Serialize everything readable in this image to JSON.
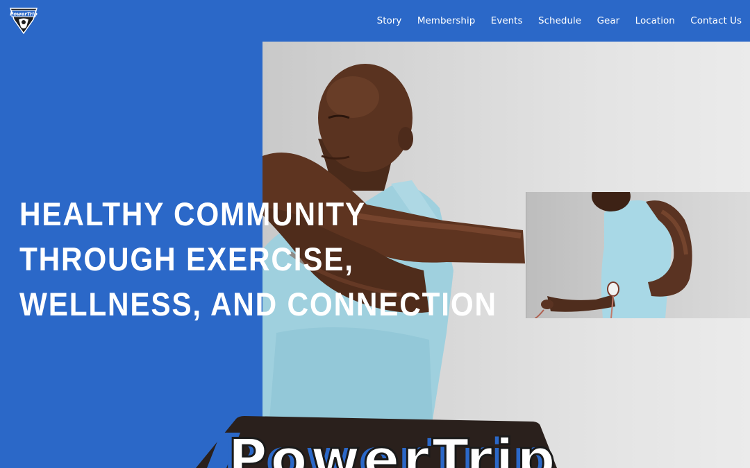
{
  "brand": {
    "logo_text": "PowerTrip",
    "badge_text": "PowerTrip"
  },
  "nav": {
    "items": [
      {
        "label": "Story"
      },
      {
        "label": "Membership"
      },
      {
        "label": "Events"
      },
      {
        "label": "Schedule"
      },
      {
        "label": "Gear"
      },
      {
        "label": "Location"
      },
      {
        "label": "Contact Us"
      }
    ]
  },
  "hero": {
    "heading_lines": [
      "HEALTHY COMMUNITY",
      "THROUGH EXERCISE,",
      "WELLNESS, AND CONNECTION"
    ]
  },
  "colors": {
    "brand_blue": "#2b68c8",
    "white": "#ffffff",
    "badge_dark": "#2a201c",
    "tank_top": "#9fd0de",
    "skin": "#5a3320"
  }
}
